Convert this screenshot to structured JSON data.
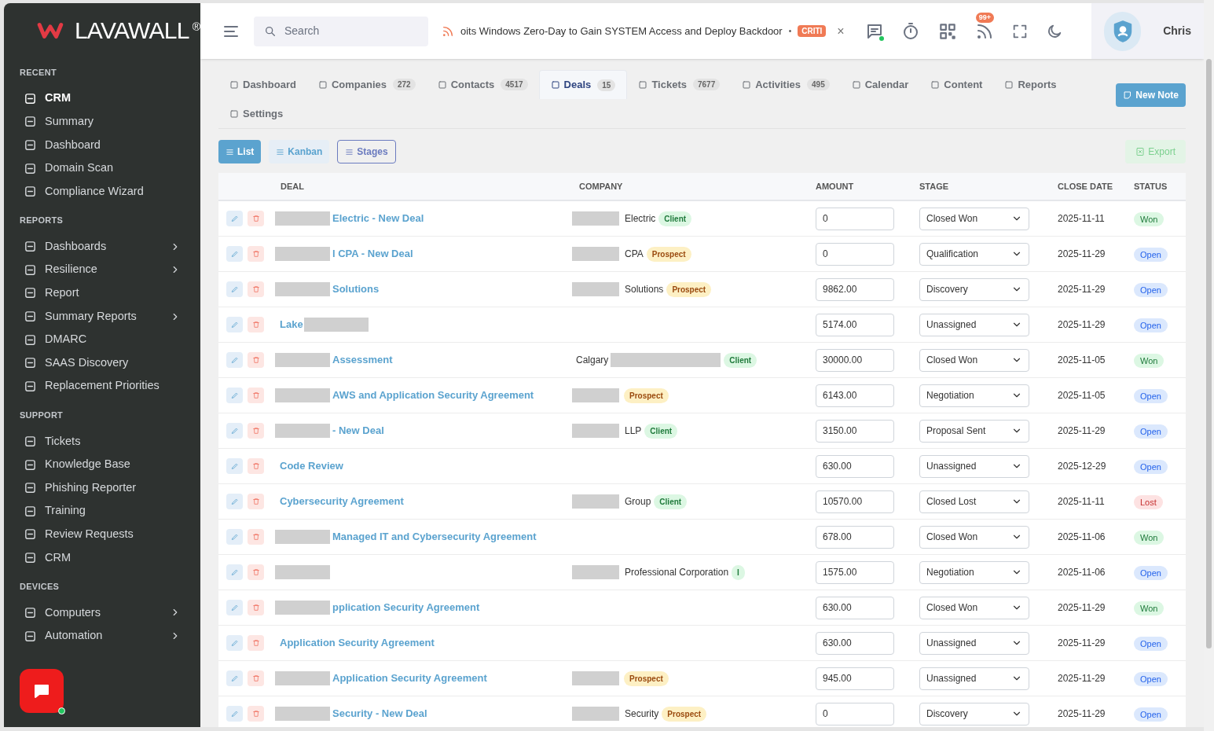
{
  "sidebar": {
    "logo": "LAVAWALL",
    "logo_mark": "®",
    "sections": [
      {
        "title": "RECENT",
        "items": [
          {
            "label": "CRM",
            "selected": true,
            "submenu": false
          },
          {
            "label": "Summary",
            "selected": false,
            "submenu": false
          },
          {
            "label": "Dashboard",
            "selected": false,
            "submenu": false
          },
          {
            "label": "Domain Scan",
            "selected": false,
            "submenu": false
          },
          {
            "label": "Compliance Wizard",
            "selected": false,
            "submenu": false
          }
        ]
      },
      {
        "title": "REPORTS",
        "items": [
          {
            "label": "Dashboards",
            "selected": false,
            "submenu": true
          },
          {
            "label": "Resilience",
            "selected": false,
            "submenu": true
          },
          {
            "label": "Report",
            "selected": false,
            "submenu": false
          },
          {
            "label": "Summary Reports",
            "selected": false,
            "submenu": true
          },
          {
            "label": "DMARC",
            "selected": false,
            "submenu": false
          },
          {
            "label": "SAAS Discovery",
            "selected": false,
            "submenu": false
          },
          {
            "label": "Replacement Priorities",
            "selected": false,
            "submenu": false
          }
        ]
      },
      {
        "title": "SUPPORT",
        "items": [
          {
            "label": "Tickets",
            "selected": false,
            "submenu": false
          },
          {
            "label": "Knowledge Base",
            "selected": false,
            "submenu": false
          },
          {
            "label": "Phishing Reporter",
            "selected": false,
            "submenu": false
          },
          {
            "label": "Training",
            "selected": false,
            "submenu": false
          },
          {
            "label": "Review Requests",
            "selected": false,
            "submenu": false
          },
          {
            "label": "CRM",
            "selected": false,
            "submenu": false
          }
        ]
      },
      {
        "title": "DEVICES",
        "items": [
          {
            "label": "Computers",
            "selected": false,
            "submenu": true
          },
          {
            "label": "Automation",
            "selected": false,
            "submenu": true
          }
        ]
      }
    ]
  },
  "topbar": {
    "search": {
      "placeholder": "Search"
    },
    "ticker": {
      "text": "oits Windows Zero-Day to Gain SYSTEM Access and Deploy Backdoor",
      "separator": "•",
      "badge": "CRITI",
      "close": "×"
    },
    "notifications": "99+",
    "user": "Chris"
  },
  "tabs": [
    {
      "label": "Dashboard",
      "selected": false
    },
    {
      "label": "Companies",
      "count": "272",
      "selected": false
    },
    {
      "label": "Contacts",
      "count": "4517",
      "selected": false
    },
    {
      "label": "Deals",
      "count": "15",
      "selected": true
    },
    {
      "label": "Tickets",
      "count": "7677",
      "selected": false
    },
    {
      "label": "Activities",
      "count": "495",
      "selected": false
    },
    {
      "label": "Calendar",
      "selected": false
    },
    {
      "label": "Content",
      "selected": false
    },
    {
      "label": "Reports",
      "selected": false
    },
    {
      "label": "Settings",
      "selected": false
    }
  ],
  "new_note": "New Note",
  "views": [
    {
      "label": "List",
      "selected": true
    },
    {
      "label": "Kanban",
      "selected": false
    },
    {
      "label": "Stages",
      "selected": false
    }
  ],
  "export": "Export",
  "table": {
    "columns": [
      "DEAL",
      "COMPANY",
      "AMOUNT",
      "STAGE",
      "CLOSE DATE",
      "STATUS"
    ],
    "rows": [
      {
        "deal": {
          "redacted_before": true,
          "text": "Electric - New Deal"
        },
        "company": {
          "redacted_before": true,
          "text": "Electric",
          "tag": {
            "text": "Client",
            "kind": "client"
          }
        },
        "amount": "0",
        "stage": "Closed Won",
        "close_date": "2025-11-11",
        "status": {
          "text": "Won",
          "kind": "won"
        }
      },
      {
        "deal": {
          "redacted_before": true,
          "text": "l CPA - New Deal"
        },
        "company": {
          "redacted_before": true,
          "text": "CPA",
          "tag": {
            "text": "Prospect",
            "kind": "prospect"
          }
        },
        "amount": "0",
        "stage": "Qualification",
        "close_date": "2025-11-29",
        "status": {
          "text": "Open",
          "kind": "open"
        }
      },
      {
        "deal": {
          "redacted_before": true,
          "text": "Solutions"
        },
        "company": {
          "redacted_before": true,
          "text": "Solutions",
          "tag": {
            "text": "Prospect",
            "kind": "prospect"
          }
        },
        "amount": "9862.00",
        "stage": "Discovery",
        "close_date": "2025-11-29",
        "status": {
          "text": "Open",
          "kind": "open"
        }
      },
      {
        "deal": {
          "redacted_after": true,
          "text": "Lake"
        },
        "amount": "5174.00",
        "stage": "Unassigned",
        "close_date": "2025-11-29",
        "status": {
          "text": "Open",
          "kind": "open"
        }
      },
      {
        "deal": {
          "redacted_before": true,
          "text": "Assessment"
        },
        "company": {
          "redacted_after": true,
          "text": "Calgary",
          "tag": {
            "text": "Client",
            "kind": "client"
          }
        },
        "amount": "30000.00",
        "stage": "Closed Won",
        "close_date": "2025-11-05",
        "status": {
          "text": "Won",
          "kind": "won"
        }
      },
      {
        "deal": {
          "redacted_before": true,
          "text": "AWS and Application Security Agreement"
        },
        "company": {
          "redacted_before": true,
          "tag": {
            "text": "Prospect",
            "kind": "prospect"
          }
        },
        "amount": "6143.00",
        "stage": "Negotiation",
        "close_date": "2025-11-05",
        "status": {
          "text": "Open",
          "kind": "open"
        }
      },
      {
        "deal": {
          "redacted_before": true,
          "text": "- New Deal"
        },
        "company": {
          "redacted_before": true,
          "text": "LLP",
          "tag": {
            "text": "Client",
            "kind": "client"
          }
        },
        "amount": "3150.00",
        "stage": "Proposal Sent",
        "close_date": "2025-11-29",
        "status": {
          "text": "Open",
          "kind": "open"
        }
      },
      {
        "deal": {
          "text": "Code Review"
        },
        "amount": "630.00",
        "stage": "Unassigned",
        "close_date": "2025-12-29",
        "status": {
          "text": "Open",
          "kind": "open"
        }
      },
      {
        "deal": {
          "text": "Cybersecurity Agreement"
        },
        "company": {
          "redacted_before": true,
          "text": "Group",
          "tag": {
            "text": "Client",
            "kind": "client"
          }
        },
        "amount": "10570.00",
        "stage": "Closed Lost",
        "close_date": "2025-11-11",
        "status": {
          "text": "Lost",
          "kind": "lost"
        }
      },
      {
        "deal": {
          "redacted_before": true,
          "text": "Managed IT and Cybersecurity Agreement"
        },
        "amount": "678.00",
        "stage": "Closed Won",
        "close_date": "2025-11-06",
        "status": {
          "text": "Won",
          "kind": "won"
        }
      },
      {
        "deal": {
          "redacted_before": true
        },
        "company": {
          "redacted_before": true,
          "text": "Professional Corporation",
          "tag": {
            "text": "I",
            "kind": "client"
          }
        },
        "amount": "1575.00",
        "stage": "Negotiation",
        "close_date": "2025-11-06",
        "status": {
          "text": "Open",
          "kind": "open"
        }
      },
      {
        "deal": {
          "redacted_before": true,
          "text": "pplication Security Agreement"
        },
        "amount": "630.00",
        "stage": "Closed Won",
        "close_date": "2025-11-29",
        "status": {
          "text": "Won",
          "kind": "won"
        }
      },
      {
        "deal": {
          "text": "Application Security Agreement"
        },
        "amount": "630.00",
        "stage": "Unassigned",
        "close_date": "2025-11-29",
        "status": {
          "text": "Open",
          "kind": "open"
        }
      },
      {
        "deal": {
          "redacted_before": true,
          "text": "Application Security Agreement"
        },
        "company": {
          "redacted_before": true,
          "tag": {
            "text": "Prospect",
            "kind": "prospect"
          }
        },
        "amount": "945.00",
        "stage": "Unassigned",
        "close_date": "2025-11-29",
        "status": {
          "text": "Open",
          "kind": "open"
        }
      },
      {
        "deal": {
          "redacted_before": true,
          "text": "Security - New Deal"
        },
        "company": {
          "redacted_before": true,
          "text": "Security",
          "tag": {
            "text": "Prospect",
            "kind": "prospect"
          }
        },
        "amount": "0",
        "stage": "Discovery",
        "close_date": "2025-11-29",
        "status": {
          "text": "Open",
          "kind": "open"
        }
      }
    ]
  }
}
